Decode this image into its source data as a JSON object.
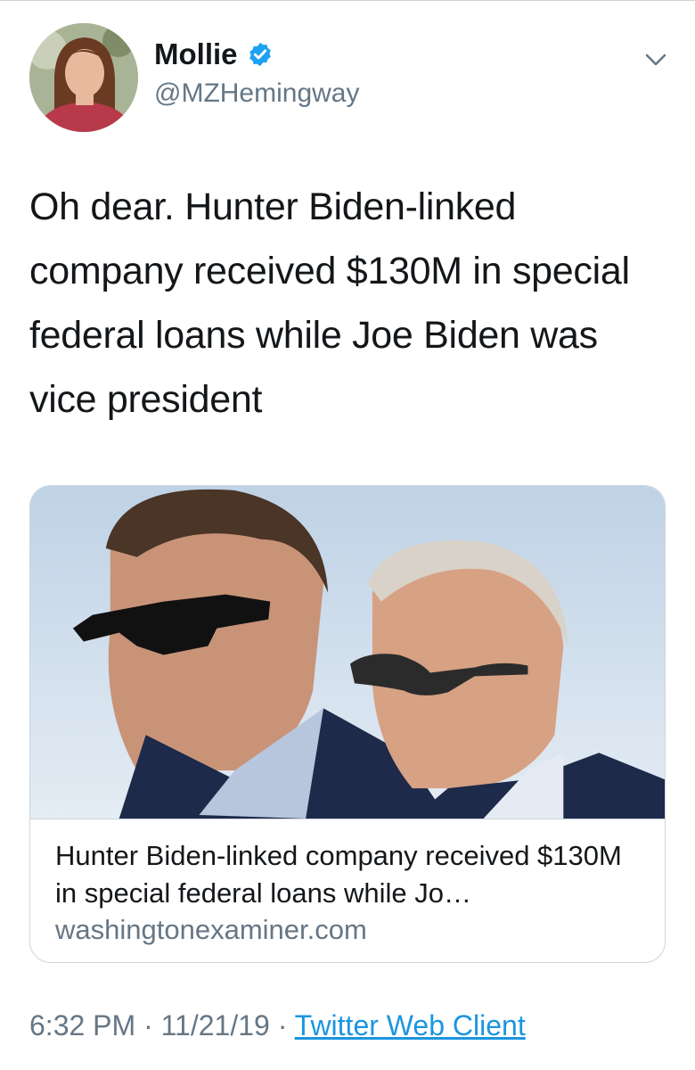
{
  "header": {
    "display_name": "Mollie",
    "handle": "@MZHemingway",
    "verified": true
  },
  "tweet": {
    "text": "Oh dear. Hunter Biden-linked company received $130M in special federal loans while Joe Biden was vice president"
  },
  "card": {
    "title": "Hunter Biden-linked company received $130M in special federal loans while Jo…",
    "domain": "washingtonexaminer.com"
  },
  "meta": {
    "time": "6:32 PM",
    "date": "11/21/19",
    "separator": " · ",
    "source": "Twitter Web Client"
  },
  "colors": {
    "text": "#14171a",
    "secondary": "#657786",
    "link": "#1b95e0",
    "verified": "#1da1f2",
    "border": "#ccd6dd"
  },
  "icons": [
    "verified-badge-icon",
    "chevron-down-icon"
  ]
}
